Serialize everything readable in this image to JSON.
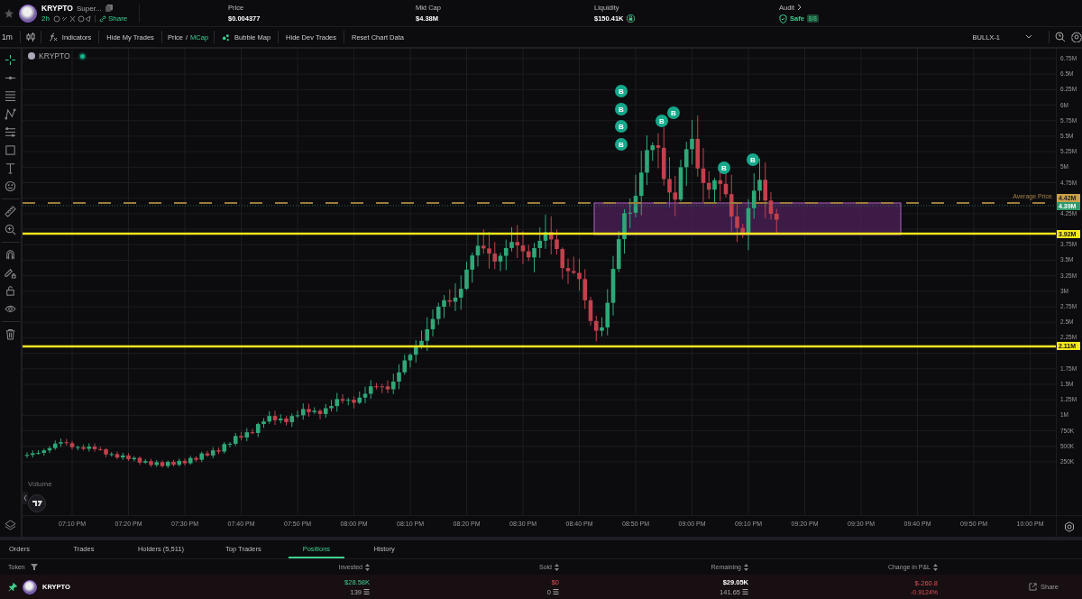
{
  "header": {
    "token_name": "KRYPTO",
    "token_subtitle": "Super...",
    "age": "2h",
    "share": "Share",
    "stats": [
      {
        "label": "Price",
        "value": "$0.004377",
        "kind": "plain"
      },
      {
        "label": "Mkt Cap",
        "value": "$4.38M",
        "kind": "plain"
      },
      {
        "label": "Liquidity",
        "value": "$150.41K",
        "kind": "liquidity"
      },
      {
        "label": "Audit",
        "value": "Safe",
        "badge": "8/8",
        "kind": "audit"
      }
    ]
  },
  "toolbar": {
    "interval": "1m",
    "indicators": "Indicators",
    "hide_my_trades": "Hide My Trades",
    "display_options": [
      {
        "label": "Price",
        "selected": false
      },
      {
        "label": "MCap",
        "selected": true
      }
    ],
    "display_divider": "/",
    "bubble_map": "Bubble Map",
    "hide_dev_trades": "Hide Dev Trades",
    "reset_chart_data": "Reset Chart Data",
    "chart_selector": "BULLX-1"
  },
  "tools": [
    {
      "kind": "crosshair",
      "selected": true
    },
    {
      "kind": "trend-line",
      "selected": false
    },
    {
      "kind": "lines",
      "selected": false
    },
    {
      "kind": "pattern",
      "selected": false
    },
    {
      "kind": "fib",
      "selected": false
    },
    {
      "kind": "rectangle",
      "selected": false
    },
    {
      "kind": "text",
      "selected": false
    },
    {
      "kind": "emoji",
      "selected": false
    },
    {
      "kind": "ruler",
      "selected": false
    },
    {
      "kind": "zoom",
      "selected": false
    },
    {
      "kind": "magnet",
      "selected": false
    },
    {
      "kind": "pencil-lock",
      "selected": false
    },
    {
      "kind": "lock",
      "selected": false
    },
    {
      "kind": "eye",
      "selected": false
    },
    {
      "kind": "trash",
      "selected": false
    }
  ],
  "chart": {
    "legend": "KRYPTO",
    "volume_label": "Volume",
    "average_price_label": "Average Price",
    "y_axis_labels": [
      "6.75M",
      "6.5M",
      "6.25M",
      "6M",
      "5.75M",
      "5.5M",
      "5.25M",
      "5M",
      "4.75M",
      "4.25M",
      "3.75M",
      "3.5M",
      "3.25M",
      "3M",
      "2.75M",
      "2.5M",
      "2.25M",
      "1.75M",
      "1.5M",
      "1.25M",
      "1M",
      "750K",
      "500K",
      "250K"
    ],
    "x_axis_labels": [
      "07:10 PM",
      "07:20 PM",
      "07:30 PM",
      "07:40 PM",
      "07:50 PM",
      "08:00 PM",
      "08:10 PM",
      "08:20 PM",
      "08:30 PM",
      "08:40 PM",
      "08:50 PM",
      "09:00 PM",
      "09:10 PM",
      "09:20 PM",
      "09:30 PM",
      "09:40 PM",
      "09:50 PM",
      "10:00 PM"
    ],
    "price_tags": [
      {
        "label": "4.42M",
        "kind": "average"
      },
      {
        "label": "4.39M",
        "kind": "current"
      },
      {
        "label": "3.92M",
        "kind": "level"
      },
      {
        "label": "2.11M",
        "kind": "level"
      }
    ],
    "trade_markers": [
      {
        "label": "B"
      },
      {
        "label": "B"
      },
      {
        "label": "B"
      },
      {
        "label": "B"
      },
      {
        "label": "B"
      },
      {
        "label": "B"
      },
      {
        "label": "B"
      },
      {
        "label": "B"
      }
    ]
  },
  "bottom": {
    "tabs": [
      {
        "label": "Orders",
        "selected": false
      },
      {
        "label": "Trades",
        "selected": false
      },
      {
        "label": "Holders (5,511)",
        "selected": false
      },
      {
        "label": "Top Traders",
        "selected": false
      },
      {
        "label": "Positions",
        "selected": true
      },
      {
        "label": "History",
        "selected": false
      }
    ],
    "columns": [
      {
        "label": "Token",
        "kind": "filter"
      },
      {
        "label": "Invested",
        "kind": "sort"
      },
      {
        "label": "Sold",
        "kind": "sort"
      },
      {
        "label": "Remaining",
        "kind": "sort"
      },
      {
        "label": "Change in P&L",
        "kind": "sort"
      }
    ],
    "rows": [
      {
        "token": "KRYPTO",
        "pinned": true,
        "invested": "$28.58K",
        "invested_tokens": "139",
        "sold": "$0",
        "sold_tokens": "0",
        "remaining": "$29.05K",
        "remaining_tokens": "141.65",
        "pnl": "$-260.8",
        "pnl_percent": "-0.9124%",
        "share": "Share"
      }
    ]
  }
}
